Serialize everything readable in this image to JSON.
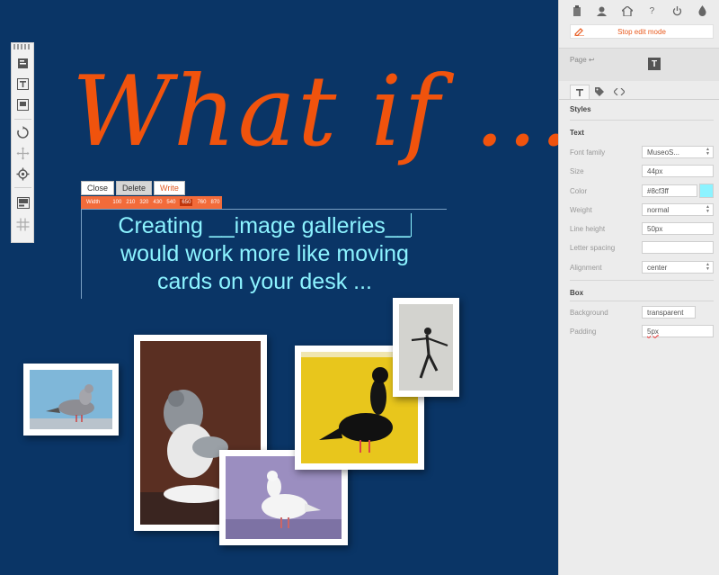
{
  "canvas": {
    "headline": "What if ...",
    "editor": {
      "buttons": {
        "close": "Close",
        "delete": "Delete",
        "write": "Write"
      },
      "width_bar": {
        "label": "Width",
        "options": [
          "100",
          "210",
          "320",
          "430",
          "540",
          "650",
          "760",
          "870"
        ],
        "selected": "650"
      },
      "text_lines": [
        "Creating __image galleries__",
        "would work more like moving",
        "cards on your desk ..."
      ],
      "text_color": "#8cf3ff"
    },
    "photos": [
      {
        "id": "pigeon-grey-small"
      },
      {
        "id": "pigeon-pouter-large"
      },
      {
        "id": "pigeon-white"
      },
      {
        "id": "pigeon-black-yellow"
      },
      {
        "id": "skater"
      }
    ]
  },
  "toolbar": {
    "tools": [
      "page-icon",
      "text-icon",
      "image-frame-icon",
      "rotate-icon",
      "move-icon",
      "target-icon",
      "layout-icon",
      "grid-icon"
    ]
  },
  "panel": {
    "top_icons": [
      "clipboard-icon",
      "user-icon",
      "home-icon",
      "help-icon",
      "power-icon",
      "drop-icon"
    ],
    "help_glyph": "?",
    "stop_edit_label": "Stop edit mode",
    "page_label": "Page ↩",
    "page_type_glyph": "T",
    "tabs": [
      "text-tab",
      "tag-tab",
      "code-tab"
    ],
    "styles_title": "Styles",
    "text_section": "Text",
    "box_section": "Box",
    "fields": {
      "font_family": {
        "label": "Font family",
        "value": "MuseoS..."
      },
      "size": {
        "label": "Size",
        "value": "44px"
      },
      "color": {
        "label": "Color",
        "value": "#8cf3ff"
      },
      "weight": {
        "label": "Weight",
        "value": "normal"
      },
      "line_height": {
        "label": "Line height",
        "value": "50px"
      },
      "letter_spacing": {
        "label": "Letter spacing",
        "value": ""
      },
      "alignment": {
        "label": "Alignment",
        "value": "center"
      },
      "background": {
        "label": "Background",
        "value": "transparent"
      },
      "padding": {
        "label": "Padding",
        "value": "5px"
      }
    },
    "accent_color": "#e85a1e"
  }
}
